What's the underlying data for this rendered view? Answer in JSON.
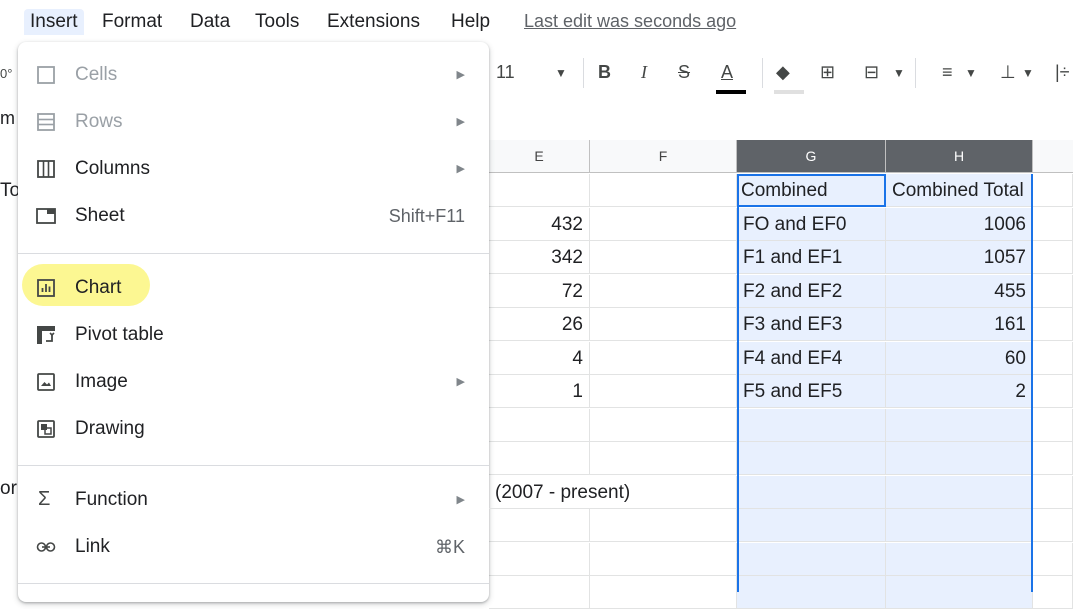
{
  "menubar": {
    "items": [
      "Insert",
      "Format",
      "Data",
      "Tools",
      "Extensions",
      "Help"
    ],
    "last_edit": "Last edit was seconds ago"
  },
  "toolbar": {
    "left_partial": "0°",
    "font_size": "11",
    "bold": "B",
    "italic": "I",
    "strike": "S",
    "text_color": "A"
  },
  "left_partials": [
    "m",
    "To",
    "or"
  ],
  "grid": {
    "columns": [
      "E",
      "F",
      "G",
      "H"
    ],
    "header_row": {
      "g": "Combined",
      "h": "Combined Total"
    },
    "e_values": [
      "432",
      "342",
      "72",
      "26",
      "4",
      "1"
    ],
    "g_values": [
      "FO and EF0",
      "F1 and EF1",
      "F2 and EF2",
      "F3 and EF3",
      "F4 and EF4",
      "F5 and EF5"
    ],
    "h_values": [
      "1006",
      "1057",
      "455",
      "161",
      "60",
      "2"
    ],
    "note": "(2007 - present)"
  },
  "insert_menu": {
    "items": [
      {
        "label": "Cells",
        "icon": "checkbox-icon",
        "disabled": true,
        "submenu": true
      },
      {
        "label": "Rows",
        "icon": "rows-icon",
        "disabled": true,
        "submenu": true
      },
      {
        "label": "Columns",
        "icon": "columns-icon",
        "disabled": false,
        "submenu": true
      },
      {
        "label": "Sheet",
        "icon": "sheet-icon",
        "shortcut": "Shift+F11"
      },
      {
        "label": "Chart",
        "icon": "chart-icon"
      },
      {
        "label": "Pivot table",
        "icon": "pivot-table-icon"
      },
      {
        "label": "Image",
        "icon": "image-icon",
        "submenu": true
      },
      {
        "label": "Drawing",
        "icon": "drawing-icon"
      },
      {
        "label": "Function",
        "icon": "sigma-icon",
        "submenu": true
      },
      {
        "label": "Link",
        "icon": "link-icon",
        "shortcut": "⌘K"
      }
    ]
  },
  "colors": {
    "selection_blue": "#1a73e8",
    "selection_fill": "#e8f0fe",
    "highlight_yellow": "#fbf46e"
  }
}
